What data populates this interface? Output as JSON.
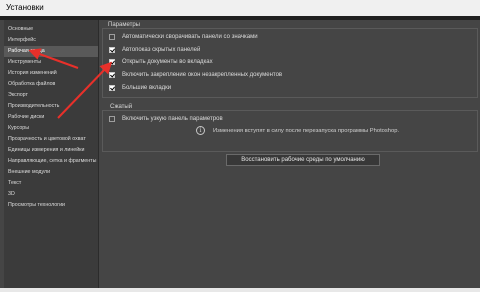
{
  "window": {
    "title": "Установки"
  },
  "sidebar": {
    "items": [
      {
        "label": "Основные"
      },
      {
        "label": "Интерфейс"
      },
      {
        "label": "Рабочая среда",
        "active": true
      },
      {
        "label": "Инструменты"
      },
      {
        "label": "История изменений"
      },
      {
        "label": "Обработка файлов"
      },
      {
        "label": "Экспорт"
      },
      {
        "label": "Производительность"
      },
      {
        "label": "Рабочие диски"
      },
      {
        "label": "Курсоры"
      },
      {
        "label": "Прозрачность и цветовой охват"
      },
      {
        "label": "Единицы измерения и линейки"
      },
      {
        "label": "Направляющие, сетка и фрагменты"
      },
      {
        "label": "Внешние модули"
      },
      {
        "label": "Текст"
      },
      {
        "label": "3D"
      },
      {
        "label": "Просмотры технологии"
      }
    ]
  },
  "params": {
    "group_label": "Параметры",
    "options": [
      {
        "label": "Автоматически сворачивать панели со значками",
        "checked": false
      },
      {
        "label": "Автопоказ скрытых панелей",
        "checked": true
      },
      {
        "label": "Открыть документы во вкладках",
        "checked": true
      },
      {
        "label": "Включить закрепление окон незакрепленных документов",
        "checked": true
      },
      {
        "label": "Большие вкладки",
        "checked": true
      }
    ]
  },
  "compact": {
    "group_label": "Сжатый",
    "option": {
      "label": "Включить узкую панель параметров",
      "checked": false
    }
  },
  "info": {
    "icon": "info-icon",
    "text": "Изменения вступят в силу после перезапуска программы Photoshop."
  },
  "restore_button": {
    "label": "Восстановить рабочие среды по умолчанию"
  },
  "colors": {
    "background": "#454545",
    "sidebar": "#3b3b3b",
    "titlebar": "#f0f0f0",
    "annotation_arrow": "#e8302a"
  }
}
